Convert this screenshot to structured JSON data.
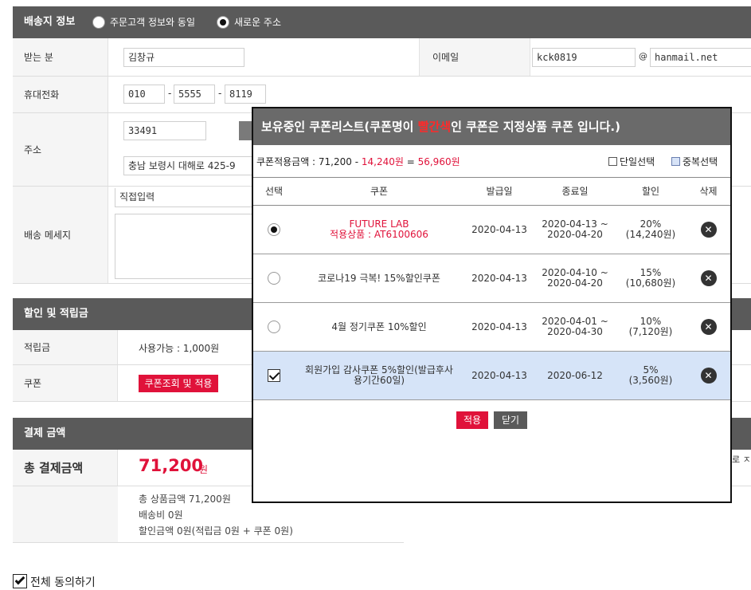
{
  "shipping": {
    "section_title": "배송지 정보",
    "option_same": "주문고객 정보와 동일",
    "option_new": "새로운 주소",
    "recipient_label": "받는 분",
    "recipient_value": "김창규",
    "email_label": "이메일",
    "email_id": "kck0819",
    "email_at": "@",
    "email_domain": "hanmail.net",
    "phone_label": "휴대전화",
    "phone_1": "010",
    "phone_2": "5555",
    "phone_3": "8119",
    "phone_sep": "-",
    "address_label": "주소",
    "zipcode": "33491",
    "address_line": "충남 보령시 대해로 425-9",
    "message_label": "배송 메세지",
    "message_select": "직접입력"
  },
  "discount": {
    "section_title": "할인 및 적립금",
    "points_label": "적립금",
    "points_value": "사용가능 : 1,000원",
    "coupon_label": "쿠폰",
    "coupon_button": "쿠폰조회 및 적용"
  },
  "payment": {
    "section_title": "결제 금액",
    "total_label": "총 결제금액",
    "total_amount": "71,200",
    "total_unit": "원",
    "side_text": "로 ㅈ",
    "product_total": "총 상품금액 71,200원",
    "shipping_fee": "배송비 0원",
    "discount_total": "할인금액 0원(적립금 0원 + 쿠폰 0원)"
  },
  "agree_all": "전체 동의하기",
  "modal": {
    "title_before": "보유중인 쿠폰리스트(쿠폰명이 ",
    "title_highlight": "빨간색",
    "title_after": "인 쿠폰은 지정상품 쿠폰 입니다.)",
    "sum_prefix": "쿠폰적용금액 : 71,200 - ",
    "sum_discount": "14,240원",
    "sum_eq": " = ",
    "sum_result": "56,960원",
    "single_select": "단일선택",
    "multi_select": "중복선택",
    "columns": [
      "선택",
      "쿠폰",
      "발급일",
      "종료일",
      "할인",
      "삭제"
    ],
    "rows": [
      {
        "name_line1": "FUTURE LAB",
        "name_line2": "적용상품 : AT6100606",
        "issued": "2020-04-13",
        "end_line1": "2020-04-13 ~",
        "end_line2": "2020-04-20",
        "discount_line1": "20%",
        "discount_line2": "(14,240원)"
      },
      {
        "name_line1": "코로나19 극복! 15%할인쿠폰",
        "name_line2": "",
        "issued": "2020-04-13",
        "end_line1": "2020-04-10 ~",
        "end_line2": "2020-04-20",
        "discount_line1": "15%",
        "discount_line2": "(10,680원)"
      },
      {
        "name_line1": "4월 정기쿠폰 10%할인",
        "name_line2": "",
        "issued": "2020-04-13",
        "end_line1": "2020-04-01 ~",
        "end_line2": "2020-04-30",
        "discount_line1": "10%",
        "discount_line2": "(7,120원)"
      },
      {
        "name_line1": "회원가입 감사쿠폰 5%할인(발급후사",
        "name_line2": "용기간60일)",
        "issued": "2020-04-13",
        "end_line1": "2020-06-12",
        "end_line2": "",
        "discount_line1": "5%",
        "discount_line2": "(3,560원)"
      }
    ],
    "delete_glyph": "✕",
    "apply_button": "적용",
    "close_button": "닫기"
  }
}
